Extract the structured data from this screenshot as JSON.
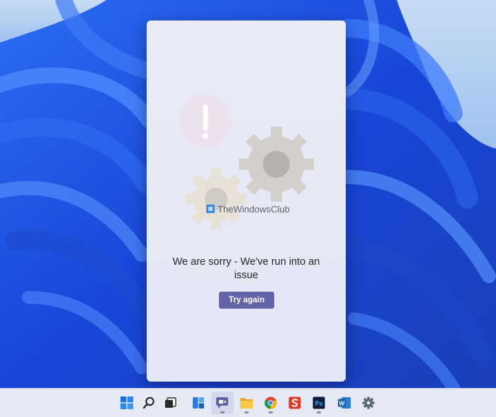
{
  "dialog": {
    "watermark": "TheWindowsClub",
    "message": "We are sorry - We've run into an issue",
    "try_again_label": "Try again"
  },
  "taskbar": {
    "icons": [
      "windows-start-icon",
      "search-icon",
      "task-view-icon",
      "widgets-icon",
      "teams-chat-icon",
      "file-explorer-icon",
      "chrome-icon",
      "snagit-icon",
      "photoshop-icon",
      "word-icon",
      "settings-icon"
    ],
    "photoshop_label": "Ps",
    "word_label": "W"
  },
  "colors": {
    "accent": "#6264a7",
    "wallpaper": "#1f57e6",
    "taskbar": "#e5e9f3"
  }
}
